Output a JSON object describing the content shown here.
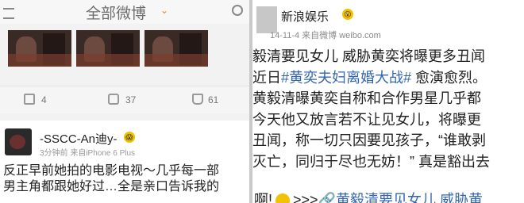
{
  "left_feed": {
    "header_title": "全部微博",
    "header_caret": "⌄",
    "actions": [
      {
        "count": "4"
      },
      {
        "count": "37"
      },
      {
        "count": "61"
      }
    ],
    "post": {
      "username": "-SSCC-An迪y-",
      "emoji": "😱",
      "meta": "3分钟前  来自iPhone 6 Plus",
      "lines": [
        "反正早前她拍的电影电视～几乎每一部",
        "男主角都跟她好过…全是亲口告诉我的"
      ]
    }
  },
  "right_post": {
    "username": "新浪娱乐",
    "emoji": "😮",
    "meta": "14-11-4  来自微博 weibo.com",
    "lines": [
      {
        "before": "毅清要见女儿 威胁黄奕将曝更多丑闻",
        "highlight": "",
        "after": ""
      },
      {
        "before": "近日",
        "highlight": "#黄奕夫妇离婚大战#",
        "after": " 愈演愈烈。"
      },
      {
        "before": "黄毅清曝黄奕自称和合作男星几乎都",
        "highlight": "",
        "after": ""
      },
      {
        "before": "今天他又放言若不让见女儿，将曝更",
        "highlight": "",
        "after": ""
      },
      {
        "before": "丑闻，称一切只因要见孩子，“谁敢剥",
        "highlight": "",
        "after": ""
      },
      {
        "before": "灭亡，同归于尽也无妨！” 真是豁出去",
        "highlight": "",
        "after": ""
      }
    ],
    "last_line": {
      "before": "啊!",
      "emoji": "😮",
      "arrows": ">>>",
      "link": "🔗黄毅清要见女儿 威胁黄"
    }
  },
  "colors": {
    "link": "#3366b0",
    "accent": "#e38a1a"
  }
}
